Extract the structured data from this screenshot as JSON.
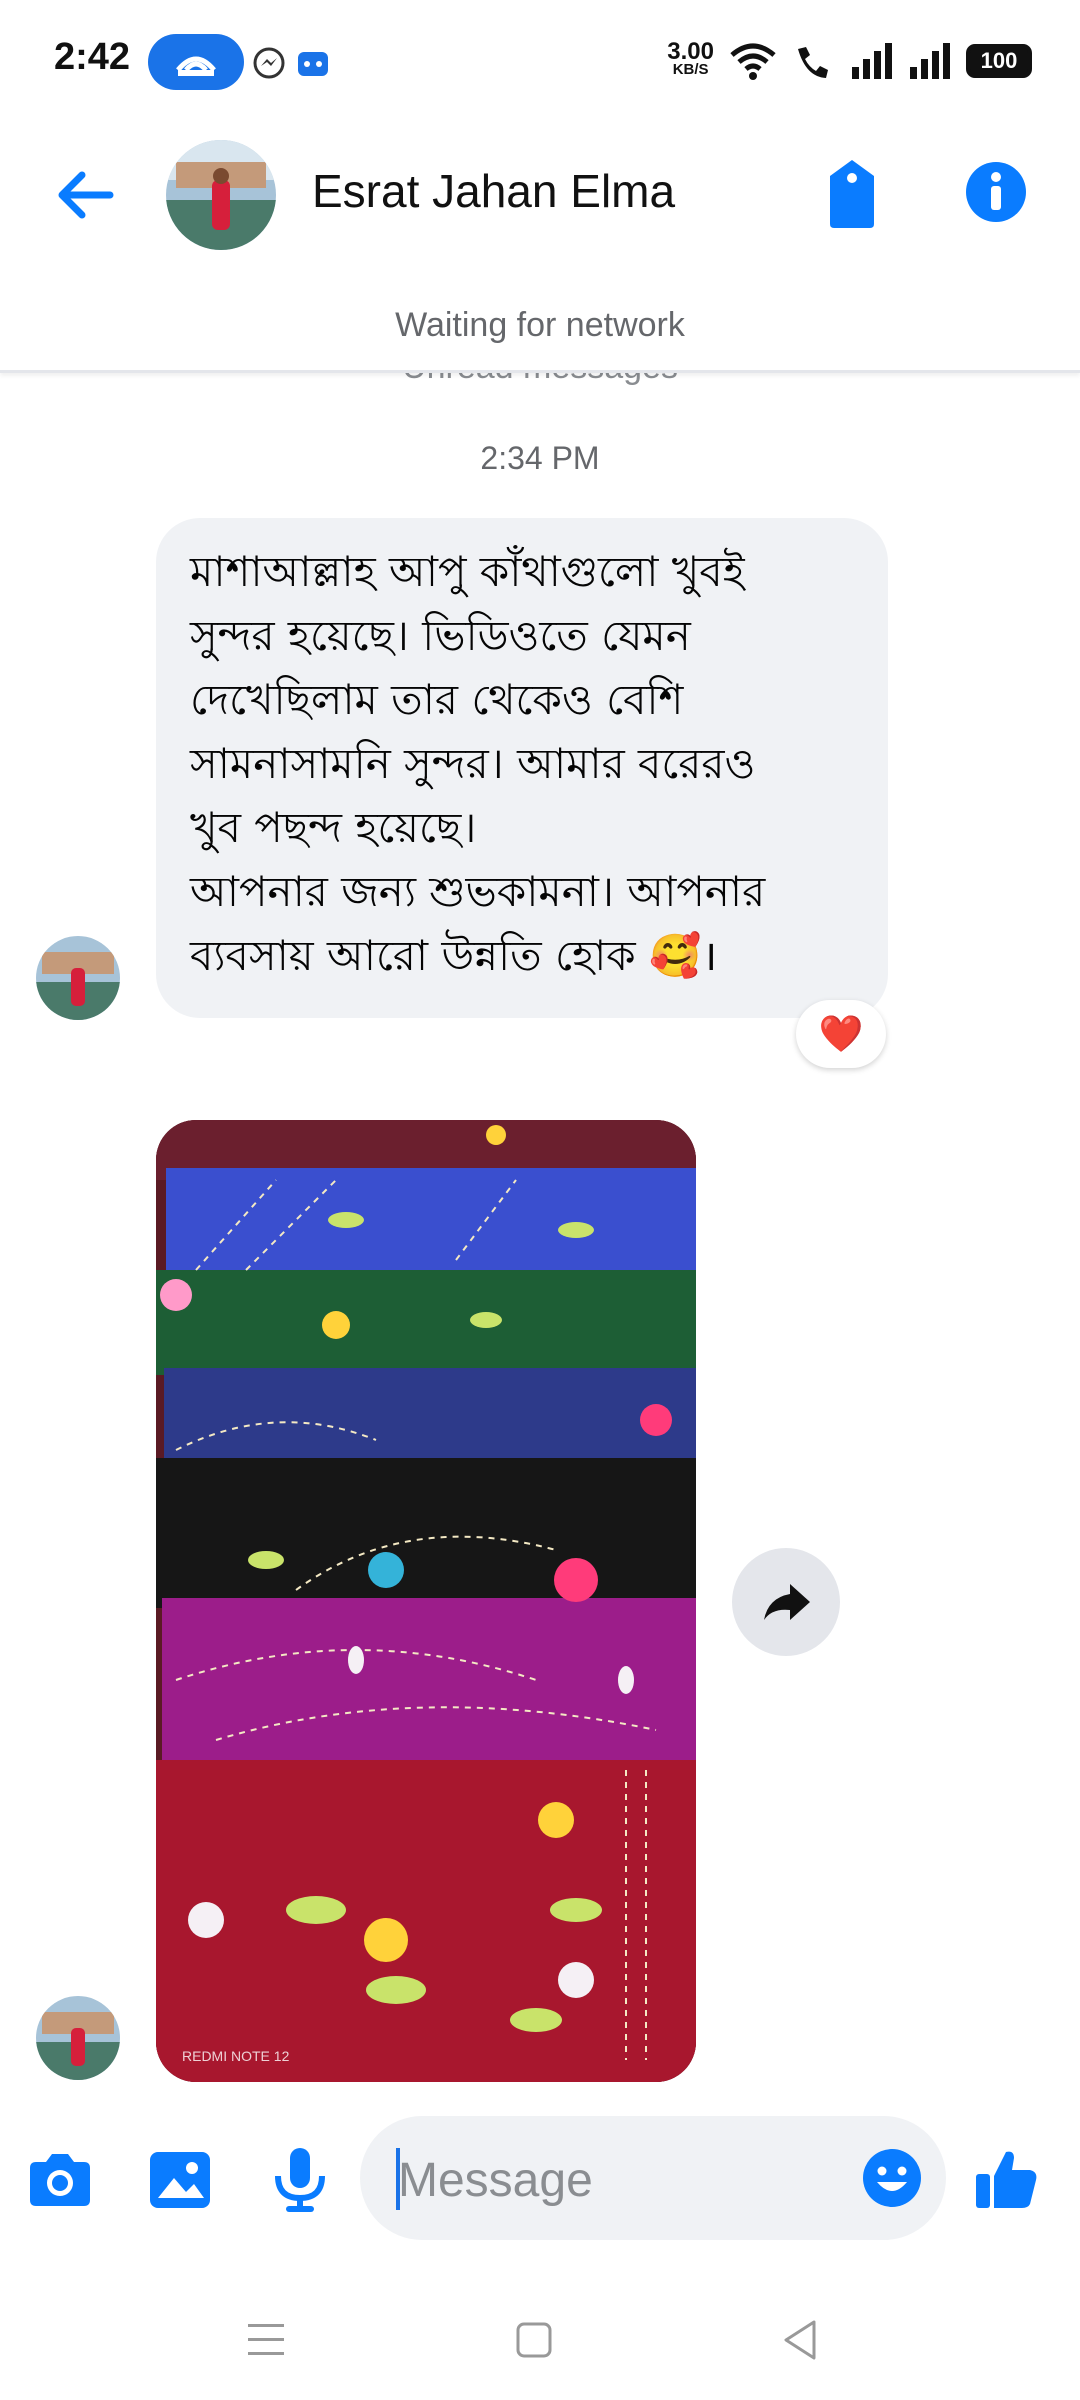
{
  "status_bar": {
    "time": "2:42",
    "net_speed_value": "3.00",
    "net_speed_unit": "KB/S",
    "battery": "100"
  },
  "header": {
    "contact_name": "Esrat Jahan Elma",
    "network_status": "Waiting for network",
    "unread_label": "Unread messages"
  },
  "conversation": {
    "timestamp": "2:34 PM",
    "message_lines": [
      "মাশাআল্লাহ আপু কাঁথাগুলো খুবই",
      "সুন্দর হয়েছে। ভিডিওতে যেমন",
      "দেখেছিলাম তার থেকেও বেশি",
      "সামনাসামনি সুন্দর। আমার বরেরও",
      "খুব পছন্দ হয়েছে।",
      "আপনার জন্য শুভকামনা। আপনার",
      "ব্যবসায় আরো উন্নতি হোক 🥰।"
    ],
    "reaction": "❤️",
    "photo_watermark": "REDMI NOTE 12"
  },
  "composer": {
    "placeholder": "Message"
  },
  "colors": {
    "accent": "#1a73e8",
    "bubble_bg": "#f0f2f5",
    "messenger_blue": "#0a7cff"
  }
}
